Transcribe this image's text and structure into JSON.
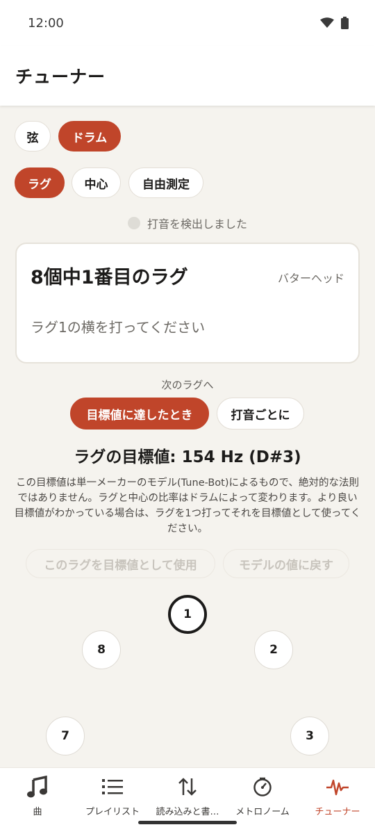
{
  "status_bar": {
    "time": "12:00"
  },
  "app_bar": {
    "title": "チューナー"
  },
  "instrument_tabs": [
    {
      "label": "弦",
      "selected": false
    },
    {
      "label": "ドラム",
      "selected": true
    }
  ],
  "mode_tabs": [
    {
      "label": "ラグ",
      "selected": true
    },
    {
      "label": "中心",
      "selected": false
    },
    {
      "label": "自由測定",
      "selected": false
    }
  ],
  "detection": {
    "text": "打音を検出しました"
  },
  "lug_card": {
    "title": "8個中1番目のラグ",
    "head": "バターヘッド",
    "instruction": "ラグ1の横を打ってください"
  },
  "advance": {
    "label": "次のラグへ",
    "options": [
      {
        "label": "目標値に達したとき",
        "selected": true
      },
      {
        "label": "打音ごとに",
        "selected": false
      }
    ]
  },
  "target": {
    "title": "ラグの目標値: 154 Hz (D#3)",
    "description": "この目標値は単一メーカーのモデル(Tune-Bot)によるもので、絶対的な法則ではありません。ラグと中心の比率はドラムによって変わります。より良い目標値がわかっている場合は、ラグを1つ打ってそれを目標値として使ってください。"
  },
  "actions": {
    "use_as_target": "このラグを目標値として使用",
    "reset_model": "モデルの値に戻す"
  },
  "lugs": [
    "1",
    "2",
    "3",
    "7",
    "8"
  ],
  "bottom_nav": [
    {
      "label": "曲",
      "icon": "music-note-icon",
      "active": false
    },
    {
      "label": "プレイリスト",
      "icon": "list-icon",
      "active": false
    },
    {
      "label": "読み込みと書…",
      "icon": "import-export-icon",
      "active": false
    },
    {
      "label": "メトロノーム",
      "icon": "metronome-icon",
      "active": false
    },
    {
      "label": "チューナー",
      "icon": "tuner-wave-icon",
      "active": true
    }
  ],
  "colors": {
    "accent": "#c0452a",
    "background": "#f5f3ee",
    "surface": "#ffffff"
  }
}
